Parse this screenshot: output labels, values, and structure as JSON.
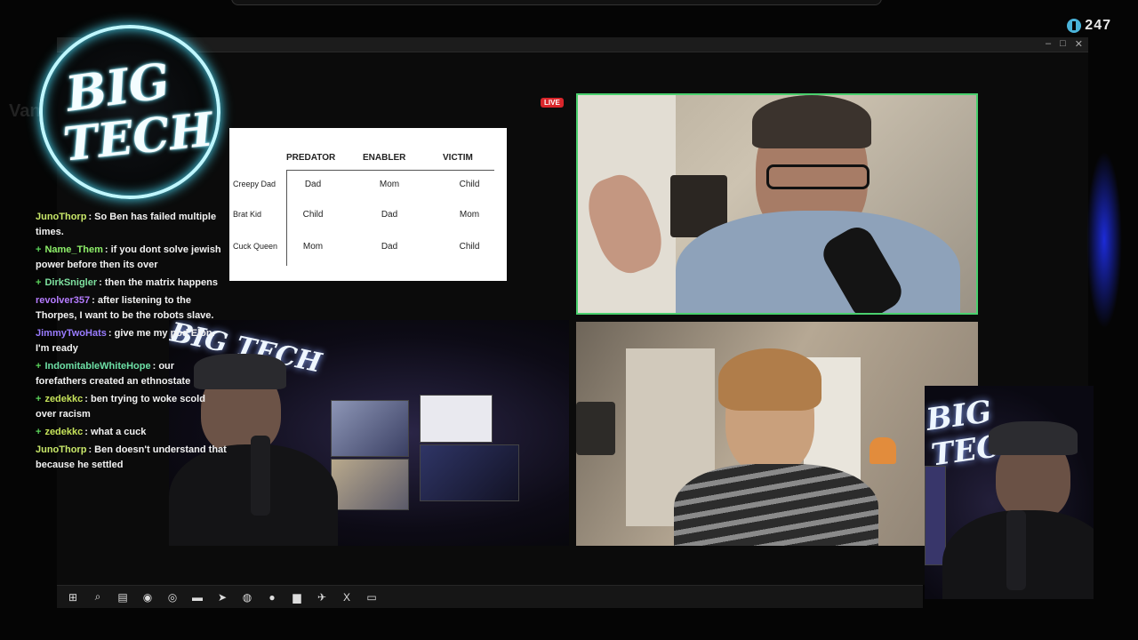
{
  "stream": {
    "viewer_count": "247",
    "live_label": "LIVE",
    "ghost_text": "Van... tweaki..."
  },
  "logo": {
    "line1": "BIG",
    "line2": "TECH"
  },
  "window_controls": {
    "minimize": "–",
    "maximize": "□",
    "close": "✕"
  },
  "chat": {
    "messages": [
      {
        "user": "JunoThorp",
        "text": ": So Ben has failed multiple times.",
        "user_color": "#c9e86a",
        "badge": ""
      },
      {
        "user": "Name_Them",
        "text": ": if you dont solve jewish power before then its over",
        "user_color": "#8ef06a",
        "badge": "+"
      },
      {
        "user": "DirkSnigler",
        "text": ": then the matrix happens",
        "user_color": "#7fe2a0",
        "badge": "+"
      },
      {
        "user": "revolver357",
        "text": ": after listening to the Thorpes, I want to be the robots slave.",
        "user_color": "#b57cff",
        "badge": ""
      },
      {
        "user": "JimmyTwoHats",
        "text": ": give me my pod Elon. I'm ready",
        "user_color": "#9a7cff",
        "badge": ""
      },
      {
        "user": "IndomitableWhiteHope",
        "text": ": our forefathers created an ethnostate",
        "user_color": "#6ee0a6",
        "badge": "+"
      },
      {
        "user": "zedekkc",
        "text": ": ben trying to woke scold over racism",
        "user_color": "#c6e35a",
        "badge": "+"
      },
      {
        "user": "zedekkc",
        "text": ": what a cuck",
        "user_color": "#c6e35a",
        "badge": "+"
      },
      {
        "user": "JunoThorp",
        "text": ": Ben doesn't understand that because he settled",
        "user_color": "#c9e86a",
        "badge": ""
      }
    ]
  },
  "slide_table": {
    "headers": [
      "PREDATOR",
      "ENABLER",
      "VICTIM"
    ],
    "rows": [
      {
        "label": "Creepy Dad",
        "cells": [
          "Dad",
          "Mom",
          "Child"
        ]
      },
      {
        "label": "Brat Kid",
        "cells": [
          "Child",
          "Dad",
          "Mom"
        ]
      },
      {
        "label": "Cuck Queen",
        "cells": [
          "Mom",
          "Dad",
          "Child"
        ]
      }
    ]
  },
  "studio": {
    "neon_sign": "BIG TECH",
    "right_neon_sign": "BIG TECH"
  },
  "taskbar": {
    "icons": [
      "windows-icon",
      "search-icon",
      "task-view-icon",
      "app-icon",
      "browser-icon",
      "folder-icon",
      "steam-icon",
      "chrome-icon",
      "obs-icon",
      "app-red-icon",
      "telegram-icon",
      "x-icon",
      "terminal-icon"
    ],
    "glyphs": [
      "⊞",
      "⌕",
      "▤",
      "◉",
      "◎",
      "▬",
      "➤",
      "◍",
      "●",
      "▆",
      "✈",
      "X",
      "▭"
    ]
  },
  "colors": {
    "live": "#d9262b",
    "cam_border": "#4ad06e",
    "logo_glow": "#4ee3ff"
  }
}
